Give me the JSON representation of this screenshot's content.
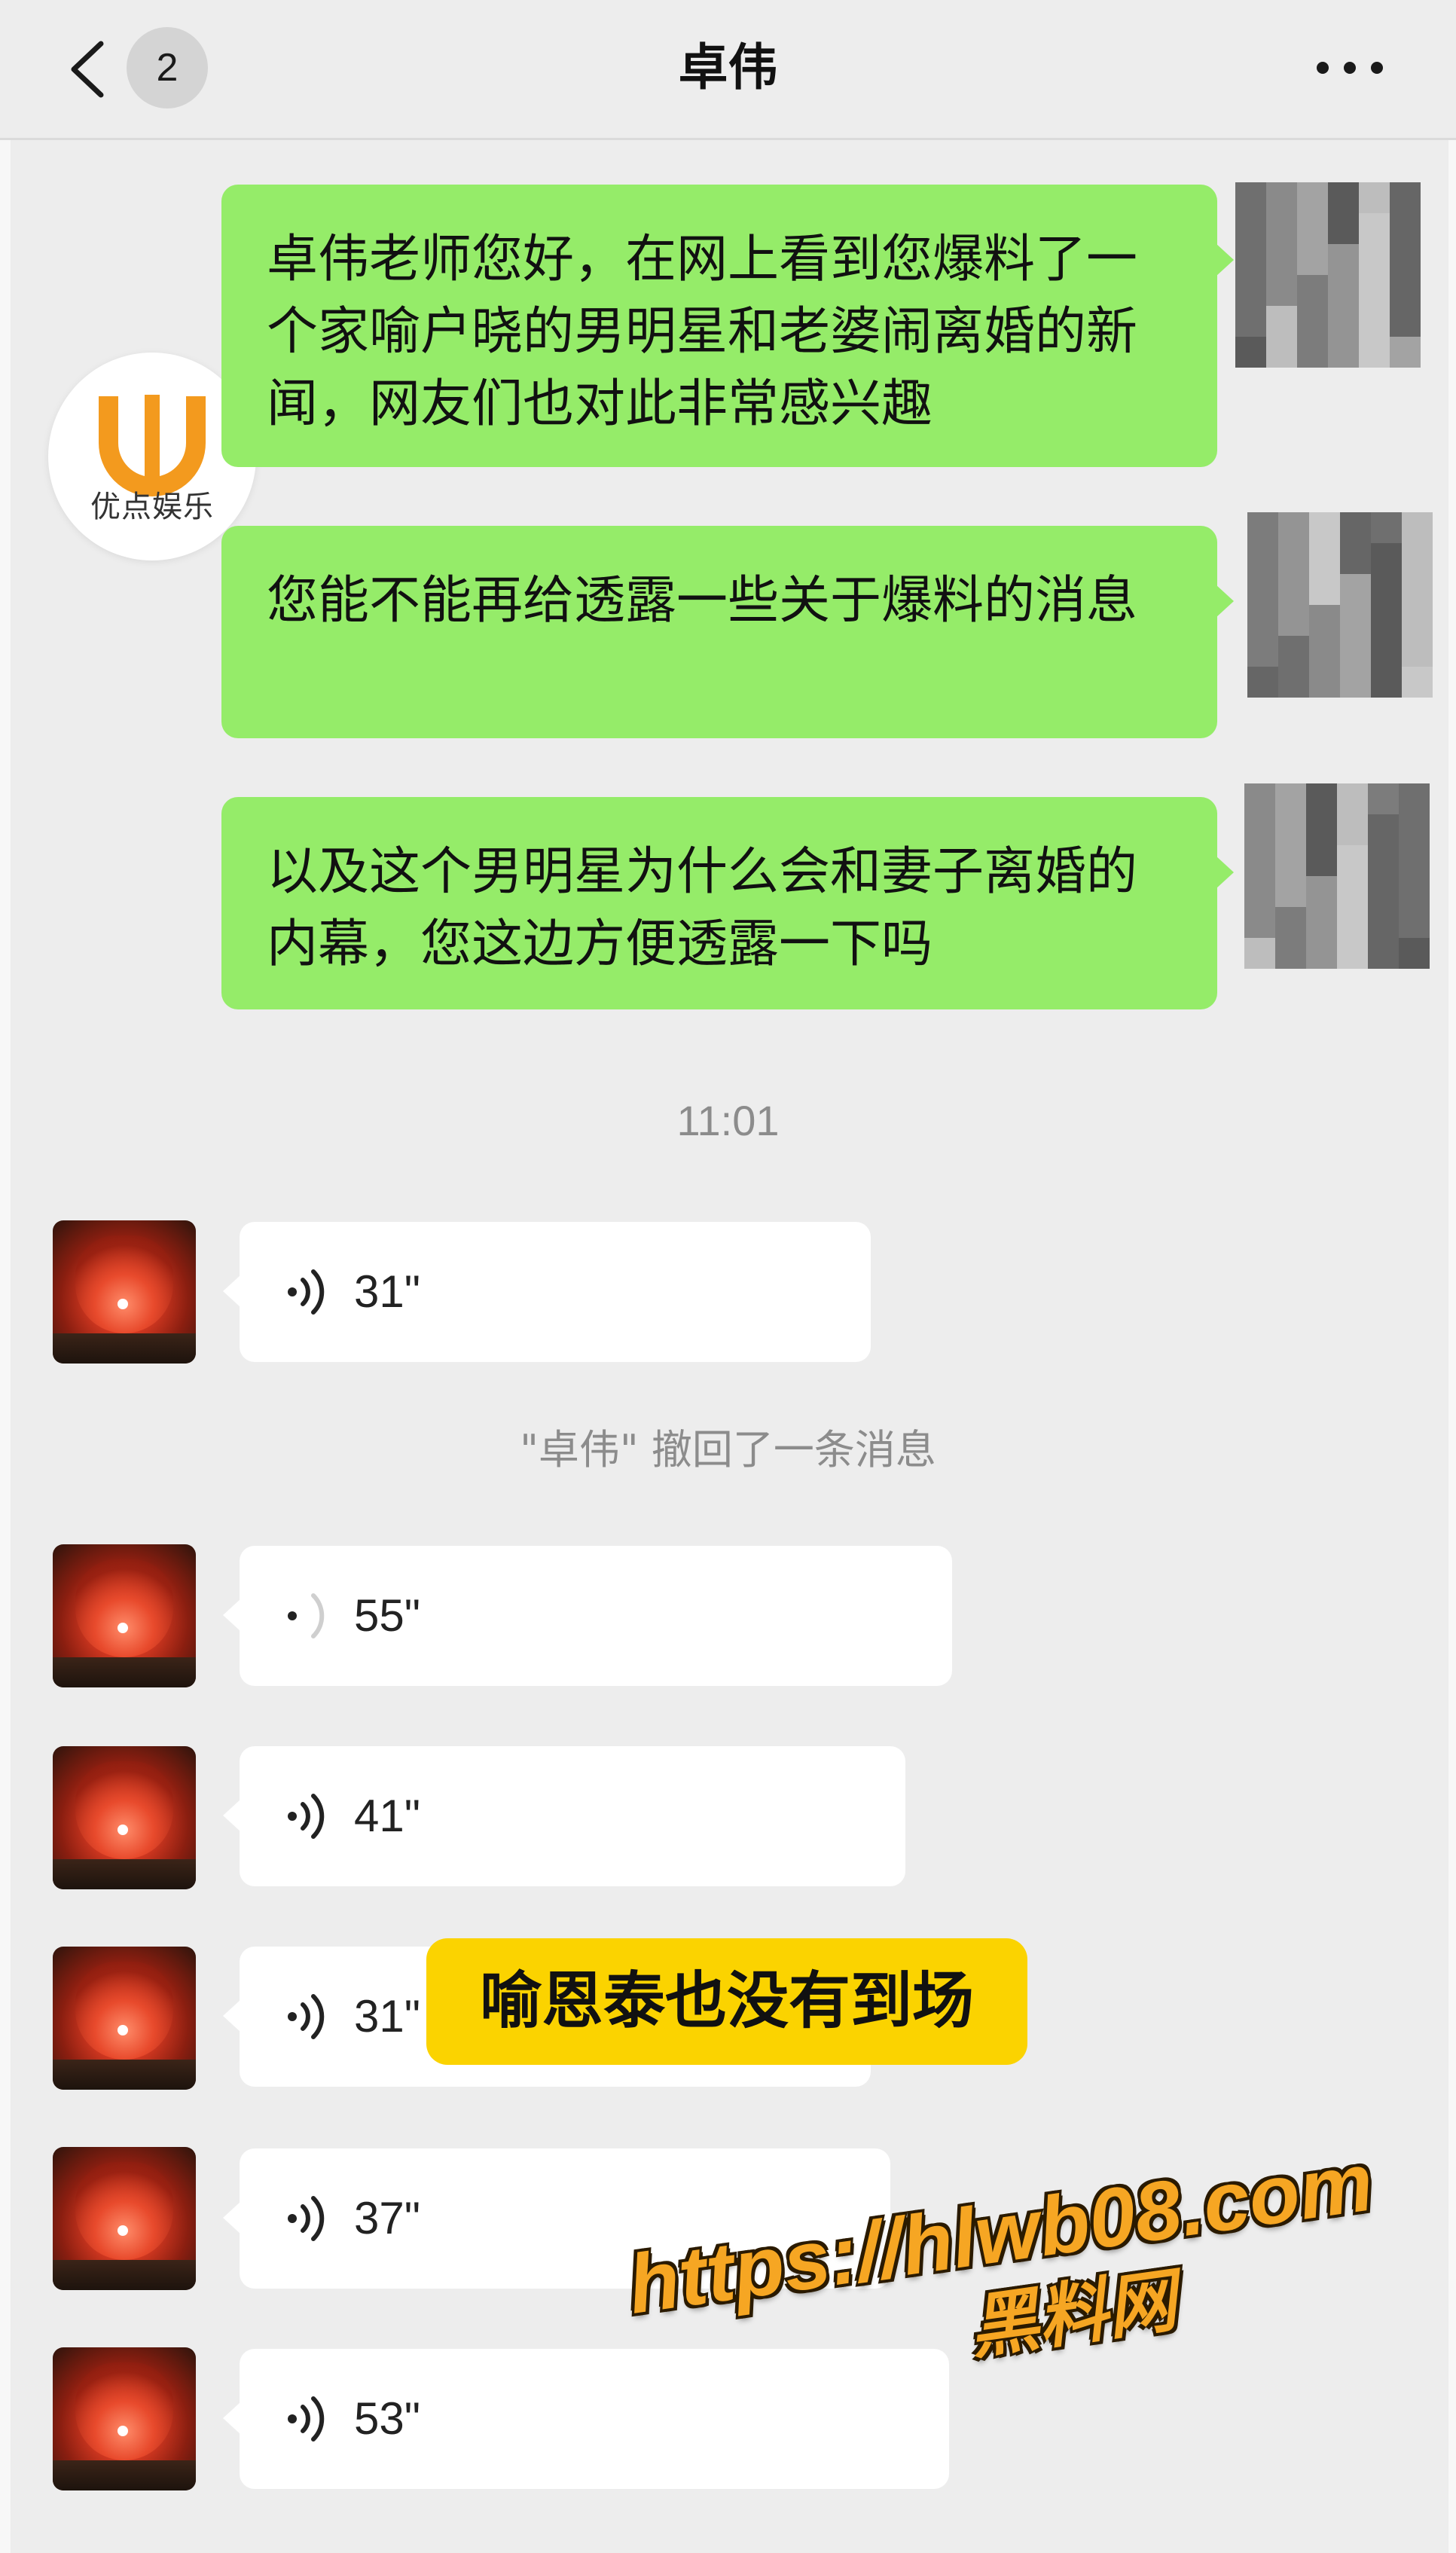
{
  "header": {
    "back_badge_count": "2",
    "title": "卓伟"
  },
  "brand_logo": {
    "text": "优点娱乐",
    "accent_color": "#f39a1e"
  },
  "outgoing_messages": [
    {
      "text": "卓伟老师您好，在网上看到您爆料了一个家喻户晓的男明星和老婆闹离婚的新闻，网友们也对此非常感兴趣"
    },
    {
      "text": "您能不能再给透露一些关于爆料的消息"
    },
    {
      "text": "以及这个男明星为什么会和妻子离婚的内幕，您这边方便透露一下吗"
    }
  ],
  "timestamp": "11:01",
  "system_note": "\"卓伟\" 撤回了一条消息",
  "voice_messages": [
    {
      "duration": "31\""
    },
    {
      "duration": "55\""
    },
    {
      "duration": "41\""
    },
    {
      "duration": "31\""
    },
    {
      "duration": "37\""
    },
    {
      "duration": "53\""
    }
  ],
  "caption": "喻恩泰也没有到场",
  "watermark": {
    "url": "https://hlwb08.com",
    "name": "黑料网"
  },
  "colors": {
    "background": "#ededed",
    "outgoing_bubble": "#95ec69",
    "incoming_bubble": "#ffffff",
    "caption_bg": "#fbd300",
    "watermark": "#f6a623"
  }
}
